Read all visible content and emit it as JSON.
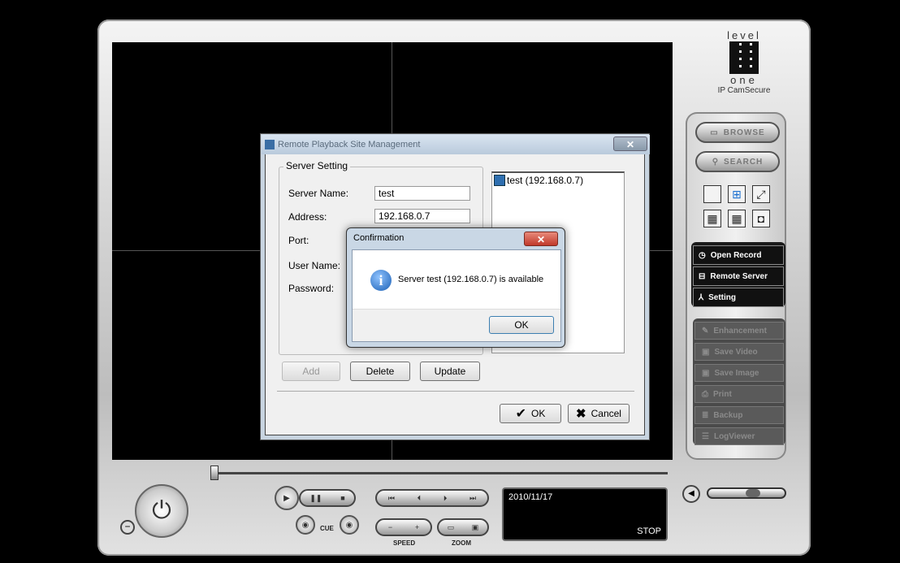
{
  "brand": {
    "top": "level",
    "bottom": "one",
    "product": "IP CamSecure"
  },
  "side": {
    "browse": "BROWSE",
    "search": "SEARCH",
    "open_record": "Open Record",
    "remote_server": "Remote Server",
    "setting": "Setting",
    "enhancement": "Enhancement",
    "save_video": "Save Video",
    "save_image": "Save Image",
    "print": "Print",
    "backup": "Backup",
    "logviewer": "LogViewer"
  },
  "controls": {
    "cue": "CUE",
    "speed": "SPEED",
    "zoom": "ZOOM",
    "date": "2010/11/17",
    "state": "STOP"
  },
  "dialog": {
    "title": "Remote Playback Site Management",
    "legend": "Server Setting",
    "server_name_label": "Server Name:",
    "server_name": "test",
    "address_label": "Address:",
    "address": "192.168.0.7",
    "port_label": "Port:",
    "username_label": "User Name:",
    "password_label": "Password:",
    "tree_item": "test (192.168.0.7)",
    "add": "Add",
    "delete": "Delete",
    "update": "Update",
    "ok": "OK",
    "cancel": "Cancel"
  },
  "confirm": {
    "title": "Confirmation",
    "message": "Server test (192.168.0.7) is available",
    "ok": "OK"
  }
}
